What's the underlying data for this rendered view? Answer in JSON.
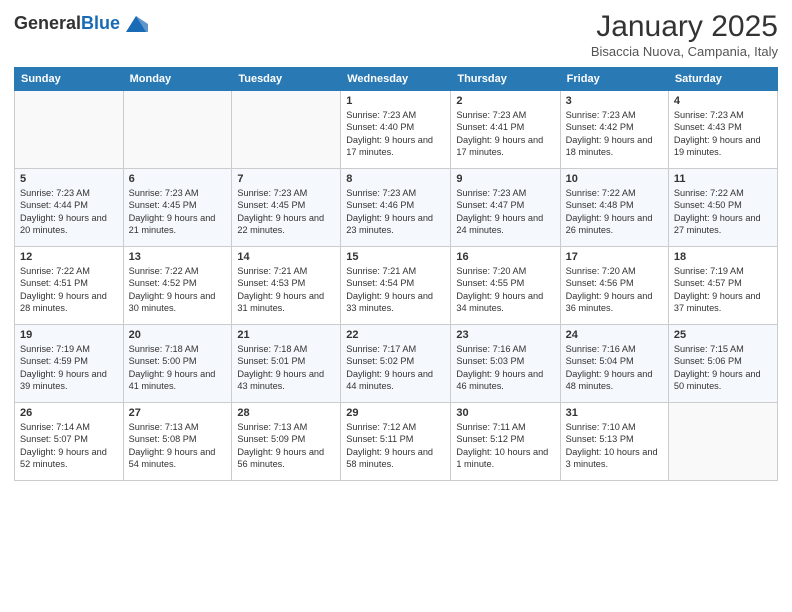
{
  "logo": {
    "general": "General",
    "blue": "Blue"
  },
  "header": {
    "month": "January 2025",
    "location": "Bisaccia Nuova, Campania, Italy"
  },
  "weekdays": [
    "Sunday",
    "Monday",
    "Tuesday",
    "Wednesday",
    "Thursday",
    "Friday",
    "Saturday"
  ],
  "weeks": [
    [
      {
        "day": "",
        "sunrise": "",
        "sunset": "",
        "daylight": ""
      },
      {
        "day": "",
        "sunrise": "",
        "sunset": "",
        "daylight": ""
      },
      {
        "day": "",
        "sunrise": "",
        "sunset": "",
        "daylight": ""
      },
      {
        "day": "1",
        "sunrise": "Sunrise: 7:23 AM",
        "sunset": "Sunset: 4:40 PM",
        "daylight": "Daylight: 9 hours and 17 minutes."
      },
      {
        "day": "2",
        "sunrise": "Sunrise: 7:23 AM",
        "sunset": "Sunset: 4:41 PM",
        "daylight": "Daylight: 9 hours and 17 minutes."
      },
      {
        "day": "3",
        "sunrise": "Sunrise: 7:23 AM",
        "sunset": "Sunset: 4:42 PM",
        "daylight": "Daylight: 9 hours and 18 minutes."
      },
      {
        "day": "4",
        "sunrise": "Sunrise: 7:23 AM",
        "sunset": "Sunset: 4:43 PM",
        "daylight": "Daylight: 9 hours and 19 minutes."
      }
    ],
    [
      {
        "day": "5",
        "sunrise": "Sunrise: 7:23 AM",
        "sunset": "Sunset: 4:44 PM",
        "daylight": "Daylight: 9 hours and 20 minutes."
      },
      {
        "day": "6",
        "sunrise": "Sunrise: 7:23 AM",
        "sunset": "Sunset: 4:45 PM",
        "daylight": "Daylight: 9 hours and 21 minutes."
      },
      {
        "day": "7",
        "sunrise": "Sunrise: 7:23 AM",
        "sunset": "Sunset: 4:45 PM",
        "daylight": "Daylight: 9 hours and 22 minutes."
      },
      {
        "day": "8",
        "sunrise": "Sunrise: 7:23 AM",
        "sunset": "Sunset: 4:46 PM",
        "daylight": "Daylight: 9 hours and 23 minutes."
      },
      {
        "day": "9",
        "sunrise": "Sunrise: 7:23 AM",
        "sunset": "Sunset: 4:47 PM",
        "daylight": "Daylight: 9 hours and 24 minutes."
      },
      {
        "day": "10",
        "sunrise": "Sunrise: 7:22 AM",
        "sunset": "Sunset: 4:48 PM",
        "daylight": "Daylight: 9 hours and 26 minutes."
      },
      {
        "day": "11",
        "sunrise": "Sunrise: 7:22 AM",
        "sunset": "Sunset: 4:50 PM",
        "daylight": "Daylight: 9 hours and 27 minutes."
      }
    ],
    [
      {
        "day": "12",
        "sunrise": "Sunrise: 7:22 AM",
        "sunset": "Sunset: 4:51 PM",
        "daylight": "Daylight: 9 hours and 28 minutes."
      },
      {
        "day": "13",
        "sunrise": "Sunrise: 7:22 AM",
        "sunset": "Sunset: 4:52 PM",
        "daylight": "Daylight: 9 hours and 30 minutes."
      },
      {
        "day": "14",
        "sunrise": "Sunrise: 7:21 AM",
        "sunset": "Sunset: 4:53 PM",
        "daylight": "Daylight: 9 hours and 31 minutes."
      },
      {
        "day": "15",
        "sunrise": "Sunrise: 7:21 AM",
        "sunset": "Sunset: 4:54 PM",
        "daylight": "Daylight: 9 hours and 33 minutes."
      },
      {
        "day": "16",
        "sunrise": "Sunrise: 7:20 AM",
        "sunset": "Sunset: 4:55 PM",
        "daylight": "Daylight: 9 hours and 34 minutes."
      },
      {
        "day": "17",
        "sunrise": "Sunrise: 7:20 AM",
        "sunset": "Sunset: 4:56 PM",
        "daylight": "Daylight: 9 hours and 36 minutes."
      },
      {
        "day": "18",
        "sunrise": "Sunrise: 7:19 AM",
        "sunset": "Sunset: 4:57 PM",
        "daylight": "Daylight: 9 hours and 37 minutes."
      }
    ],
    [
      {
        "day": "19",
        "sunrise": "Sunrise: 7:19 AM",
        "sunset": "Sunset: 4:59 PM",
        "daylight": "Daylight: 9 hours and 39 minutes."
      },
      {
        "day": "20",
        "sunrise": "Sunrise: 7:18 AM",
        "sunset": "Sunset: 5:00 PM",
        "daylight": "Daylight: 9 hours and 41 minutes."
      },
      {
        "day": "21",
        "sunrise": "Sunrise: 7:18 AM",
        "sunset": "Sunset: 5:01 PM",
        "daylight": "Daylight: 9 hours and 43 minutes."
      },
      {
        "day": "22",
        "sunrise": "Sunrise: 7:17 AM",
        "sunset": "Sunset: 5:02 PM",
        "daylight": "Daylight: 9 hours and 44 minutes."
      },
      {
        "day": "23",
        "sunrise": "Sunrise: 7:16 AM",
        "sunset": "Sunset: 5:03 PM",
        "daylight": "Daylight: 9 hours and 46 minutes."
      },
      {
        "day": "24",
        "sunrise": "Sunrise: 7:16 AM",
        "sunset": "Sunset: 5:04 PM",
        "daylight": "Daylight: 9 hours and 48 minutes."
      },
      {
        "day": "25",
        "sunrise": "Sunrise: 7:15 AM",
        "sunset": "Sunset: 5:06 PM",
        "daylight": "Daylight: 9 hours and 50 minutes."
      }
    ],
    [
      {
        "day": "26",
        "sunrise": "Sunrise: 7:14 AM",
        "sunset": "Sunset: 5:07 PM",
        "daylight": "Daylight: 9 hours and 52 minutes."
      },
      {
        "day": "27",
        "sunrise": "Sunrise: 7:13 AM",
        "sunset": "Sunset: 5:08 PM",
        "daylight": "Daylight: 9 hours and 54 minutes."
      },
      {
        "day": "28",
        "sunrise": "Sunrise: 7:13 AM",
        "sunset": "Sunset: 5:09 PM",
        "daylight": "Daylight: 9 hours and 56 minutes."
      },
      {
        "day": "29",
        "sunrise": "Sunrise: 7:12 AM",
        "sunset": "Sunset: 5:11 PM",
        "daylight": "Daylight: 9 hours and 58 minutes."
      },
      {
        "day": "30",
        "sunrise": "Sunrise: 7:11 AM",
        "sunset": "Sunset: 5:12 PM",
        "daylight": "Daylight: 10 hours and 1 minute."
      },
      {
        "day": "31",
        "sunrise": "Sunrise: 7:10 AM",
        "sunset": "Sunset: 5:13 PM",
        "daylight": "Daylight: 10 hours and 3 minutes."
      },
      {
        "day": "",
        "sunrise": "",
        "sunset": "",
        "daylight": ""
      }
    ]
  ]
}
